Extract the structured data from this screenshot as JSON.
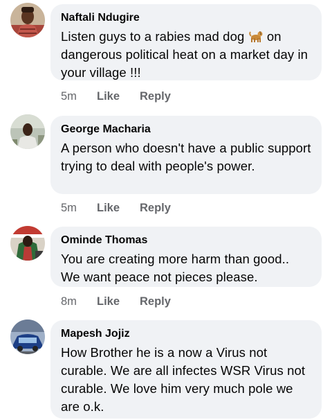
{
  "comments": [
    {
      "author": "Naftali Ndugire",
      "text_before": "Listen guys to a rabies mad dog ",
      "emoji": "dog-emoji",
      "text_after": " on dangerous political heat on a market day in your village !!!",
      "time": "5m",
      "like": "Like",
      "reply": "Reply"
    },
    {
      "author": "George Macharia",
      "text": "A person who doesn't have a public support trying to deal with people's power.",
      "time": "5m",
      "like": "Like",
      "reply": "Reply"
    },
    {
      "author": "Ominde Thomas",
      "text": "You are creating more harm than good.. We want peace not pieces please.",
      "time": "8m",
      "like": "Like",
      "reply": "Reply"
    },
    {
      "author": "Mapesh Jojiz",
      "text": "How Brother he is a now a  Virus not curable. We are all infectes WSR Virus not curable. We love him very much pole we are o.k."
    }
  ],
  "colors": {
    "bubble": "#f0f2f5",
    "meta": "#65676b",
    "text": "#050505"
  }
}
